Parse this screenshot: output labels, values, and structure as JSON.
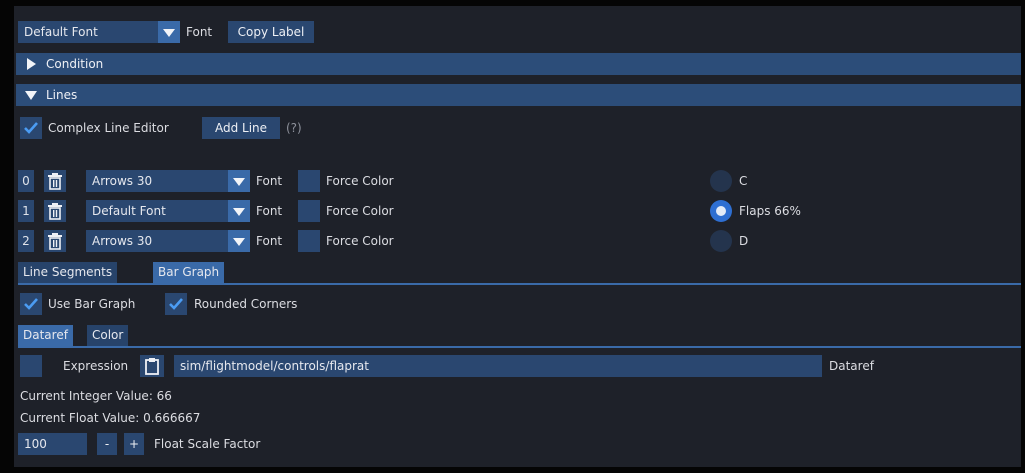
{
  "font_row": {
    "font_value": "Default Font",
    "font_label": "Font",
    "copy_label": "Copy Label"
  },
  "sections": {
    "condition": "Condition",
    "lines": "Lines"
  },
  "line_editor": {
    "complex_label": "Complex Line Editor",
    "complex_checked": true,
    "add_line": "Add Line",
    "help": "(?)"
  },
  "lines": [
    {
      "index": "0",
      "font": "Arrows 30",
      "font_label": "Font",
      "force_color": "Force Color",
      "radio_label": "C",
      "selected": false
    },
    {
      "index": "1",
      "font": "Default Font",
      "font_label": "Font",
      "force_color": "Force Color",
      "radio_label": "Flaps 66%",
      "selected": true
    },
    {
      "index": "2",
      "font": "Arrows 30",
      "font_label": "Font",
      "force_color": "Force Color",
      "radio_label": "D",
      "selected": false
    }
  ],
  "line_tabs": [
    {
      "label": "Line Segments",
      "active": false
    },
    {
      "label": "Bar Graph",
      "active": true
    }
  ],
  "bar_graph": {
    "use_bar_graph": "Use Bar Graph",
    "rounded_corners": "Rounded Corners",
    "use_checked": true,
    "rounded_checked": true
  },
  "bar_tabs": [
    {
      "label": "Dataref",
      "active": true
    },
    {
      "label": "Color",
      "active": false
    }
  ],
  "dataref": {
    "expression_label": "Expression",
    "path": "sim/flightmodel/controls/flaprat",
    "dataref_label": "Dataref",
    "current_integer": "Current Integer Value: 66",
    "current_float": "Current Float Value: 0.666667"
  },
  "scale": {
    "value": "100",
    "minus": "-",
    "plus": "+",
    "label": "Float Scale Factor"
  },
  "colors": {
    "accent": "#3a6aa8",
    "frame": "#2a4770",
    "header": "#2c4d79",
    "radio_on": "#2e6fd2",
    "background": "#1e2129"
  }
}
